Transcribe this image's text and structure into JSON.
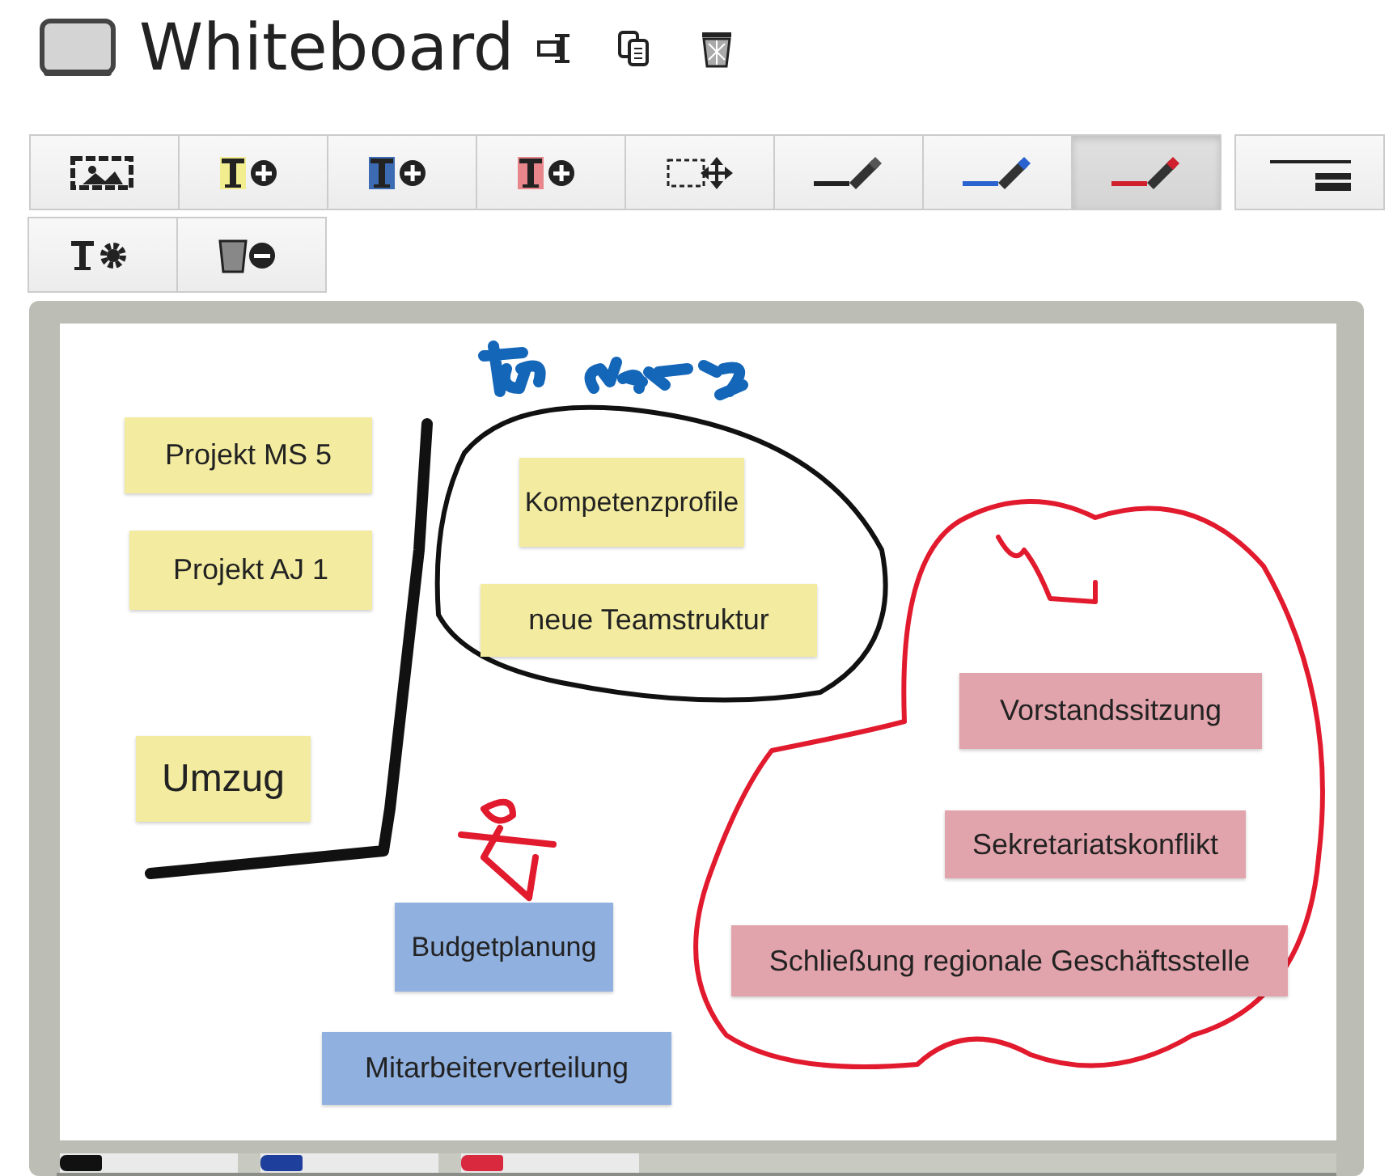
{
  "title": "Whiteboard",
  "toolbar": [
    {
      "kind": "image",
      "selected": false
    },
    {
      "kind": "note-yellow",
      "selected": false
    },
    {
      "kind": "note-blue",
      "selected": false
    },
    {
      "kind": "note-red",
      "selected": false
    },
    {
      "kind": "select",
      "selected": false
    },
    {
      "kind": "pen-black",
      "selected": false
    },
    {
      "kind": "pen-blue",
      "selected": false
    },
    {
      "kind": "pen-red",
      "selected": true
    },
    {
      "kind": "lines",
      "selected": false
    },
    {
      "kind": "note-settings",
      "selected": false
    },
    {
      "kind": "delete-note",
      "selected": false
    }
  ],
  "notes": [
    {
      "text": "Projekt MS 5",
      "color": "#f3eca0"
    },
    {
      "text": "Projekt AJ 1",
      "color": "#f3eca0"
    },
    {
      "text": "Umzug",
      "color": "#f3eca0"
    },
    {
      "text": "Kompetenzprofile",
      "color": "#f3eca0"
    },
    {
      "text": "neue Teamstruktur",
      "color": "#f3eca0"
    },
    {
      "text": "Budgetplanung",
      "color": "#90b0e0"
    },
    {
      "text": "Mitarbeiterverteilung",
      "color": "#90b0e0"
    },
    {
      "text": "Vorstandssitzung",
      "color": "#e2a4ac"
    },
    {
      "text": "Sekretariatskonflikt",
      "color": "#e2a4ac"
    },
    {
      "text": "Schließung regionale Geschäftsstelle",
      "color": "#e2a4ac"
    }
  ]
}
